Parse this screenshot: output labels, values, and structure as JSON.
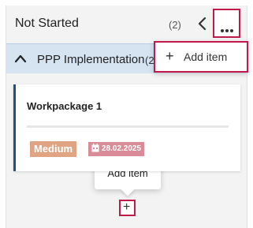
{
  "column": {
    "title": "Not Started",
    "count": "(2)"
  },
  "group": {
    "title": "PPP Implementation",
    "count": "(2"
  },
  "menu": {
    "add_item_label": "Add item"
  },
  "card": {
    "title": "Workpackage 1",
    "priority": "Medium",
    "date": "28.02.2025"
  },
  "tooltip": {
    "text": "Add item"
  },
  "icons": {
    "collapse": "chevron-left-icon",
    "more": "more-horizontal-icon",
    "group_toggle": "chevron-up-icon",
    "menu_add": "plus-icon",
    "date": "calendar-icon",
    "add": "plus-icon"
  },
  "colors": {
    "accent_outline": "#c21a4a",
    "group_bg": "#d6e4f2",
    "card_border": "#1d4f91",
    "priority_badge": "#e0a482",
    "date_badge": "#d98c98"
  }
}
